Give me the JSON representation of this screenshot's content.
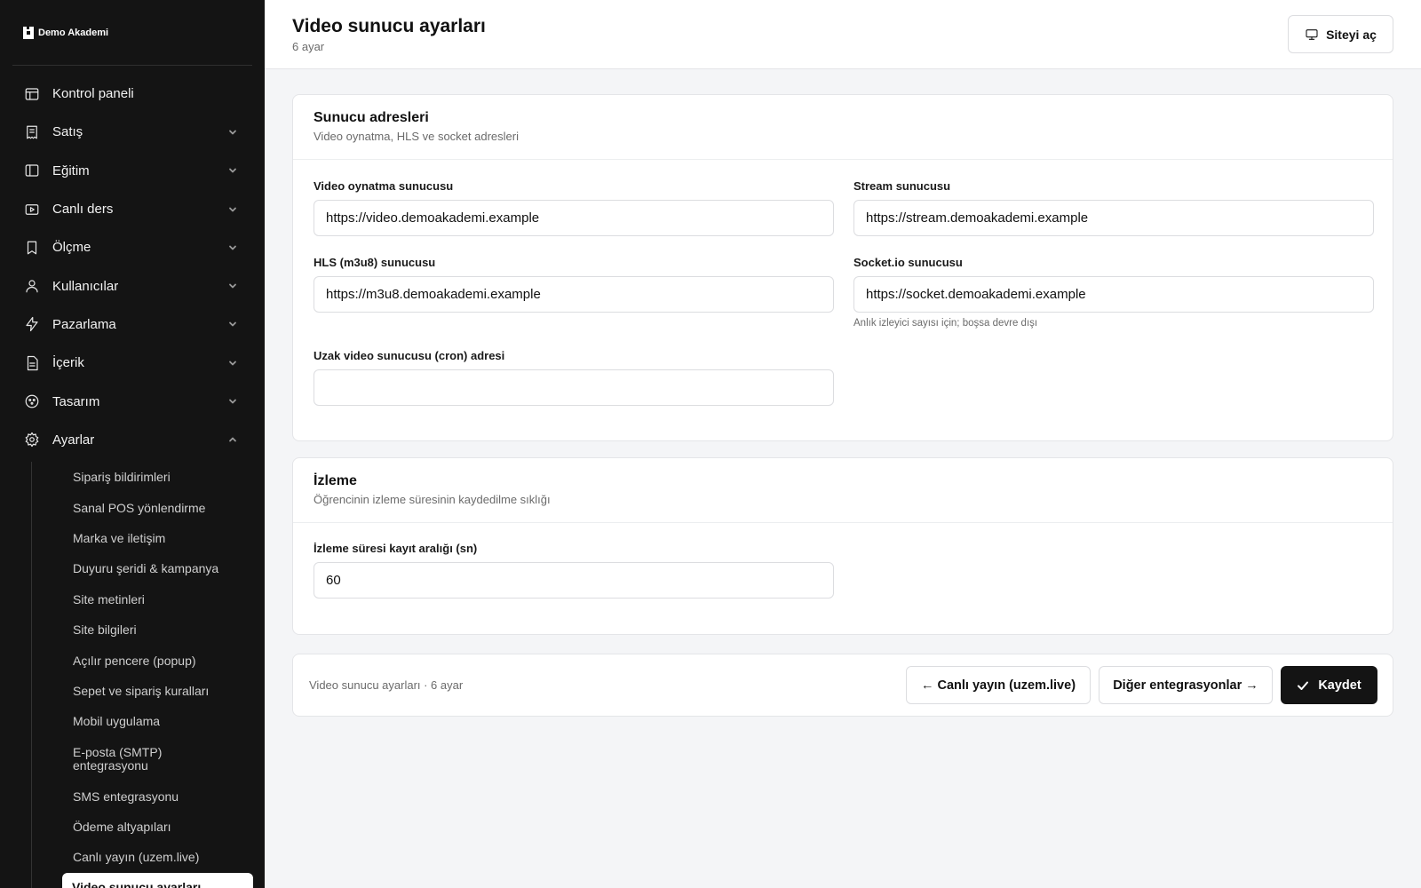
{
  "brand": {
    "name": "Demo Akademi"
  },
  "sidebar": {
    "items": [
      {
        "label": "Kontrol paneli",
        "icon": "layout-icon",
        "expandable": false
      },
      {
        "label": "Satış",
        "icon": "receipt-icon",
        "expandable": true
      },
      {
        "label": "Eğitim",
        "icon": "panel-icon",
        "expandable": true
      },
      {
        "label": "Canlı ders",
        "icon": "video-icon",
        "expandable": true
      },
      {
        "label": "Ölçme",
        "icon": "bookmark-icon",
        "expandable": true
      },
      {
        "label": "Kullanıcılar",
        "icon": "user-icon",
        "expandable": true
      },
      {
        "label": "Pazarlama",
        "icon": "bolt-icon",
        "expandable": true
      },
      {
        "label": "İçerik",
        "icon": "document-icon",
        "expandable": true
      },
      {
        "label": "Tasarım",
        "icon": "palette-icon",
        "expandable": true
      },
      {
        "label": "Ayarlar",
        "icon": "gear-icon",
        "expandable": true,
        "expanded": true
      }
    ],
    "subitems": [
      "Sipariş bildirimleri",
      "Sanal POS yönlendirme",
      "Marka ve iletişim",
      "Duyuru şeridi & kampanya",
      "Site metinleri",
      "Site bilgileri",
      "Açılır pencere (popup)",
      "Sepet ve sipariş kuralları",
      "Mobil uygulama",
      "E-posta (SMTP) entegrasyonu",
      "SMS entegrasyonu",
      "Ödeme altyapıları",
      "Canlı yayın (uzem.live)",
      "Video sunucu ayarları"
    ],
    "active_subitem": "Video sunucu ayarları"
  },
  "header": {
    "title": "Video sunucu ayarları",
    "subtitle": "6 ayar",
    "open_site_label": "Siteyi aç"
  },
  "servers_card": {
    "title": "Sunucu adresleri",
    "description": "Video oynatma, HLS ve socket adresleri",
    "fields": {
      "video": {
        "label": "Video oynatma sunucusu",
        "value": "https://video.demoakademi.example"
      },
      "stream": {
        "label": "Stream sunucusu",
        "value": "https://stream.demoakademi.example"
      },
      "hls": {
        "label": "HLS (m3u8) sunucusu",
        "value": "https://m3u8.demoakademi.example"
      },
      "socket": {
        "label": "Socket.io sunucusu",
        "value": "https://socket.demoakademi.example",
        "help": "Anlık izleyici sayısı için; boşsa devre dışı"
      },
      "cron": {
        "label": "Uzak video sunucusu (cron) adresi",
        "value": ""
      }
    }
  },
  "watch_card": {
    "title": "İzleme",
    "description": "Öğrencinin izleme süresinin kaydedilme sıklığı",
    "fields": {
      "interval": {
        "label": "İzleme süresi kayıt aralığı (sn)",
        "value": "60"
      }
    }
  },
  "footer": {
    "summary": "Video sunucu ayarları · 6 ayar",
    "prev_label": "← Canlı yayın (uzem.live)",
    "next_label": "Diğer entegrasyonlar →",
    "save_label": "Kaydet"
  },
  "colors": {
    "sidebar_bg": "#141414",
    "page_bg": "#f4f5f7",
    "primary_button": "#141414"
  }
}
